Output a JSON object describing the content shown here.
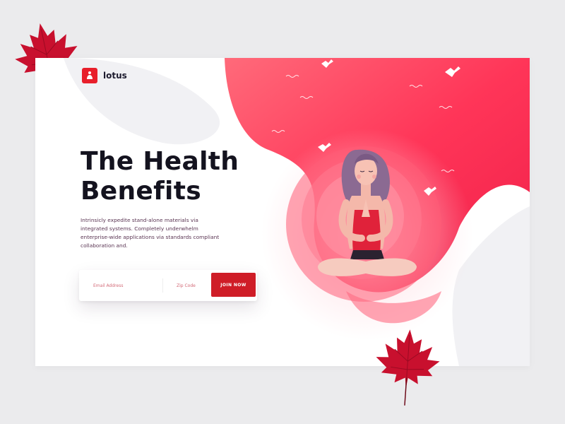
{
  "brand": {
    "name": "lotus"
  },
  "hero": {
    "title_line1": "The Health",
    "title_line2": "Benefits",
    "description": "Intrinsicly expedite stand-alone materials via integrated systems. Completely underwhelm enterprise-wide applications via standards compliant collaboration and."
  },
  "signup": {
    "email_placeholder": "Email Address",
    "zip_placeholder": "Zip Code",
    "join_label": "JOIN NOW"
  },
  "colors": {
    "accent": "#e81f2b",
    "accent_dark": "#cf1d27",
    "pink": "#ff3b5c",
    "ink": "#14131f"
  },
  "icons": {
    "logo": "lotus-meditation-icon",
    "decor": [
      "maple-leaf-icon",
      "bird-icon",
      "wave-icon"
    ]
  }
}
